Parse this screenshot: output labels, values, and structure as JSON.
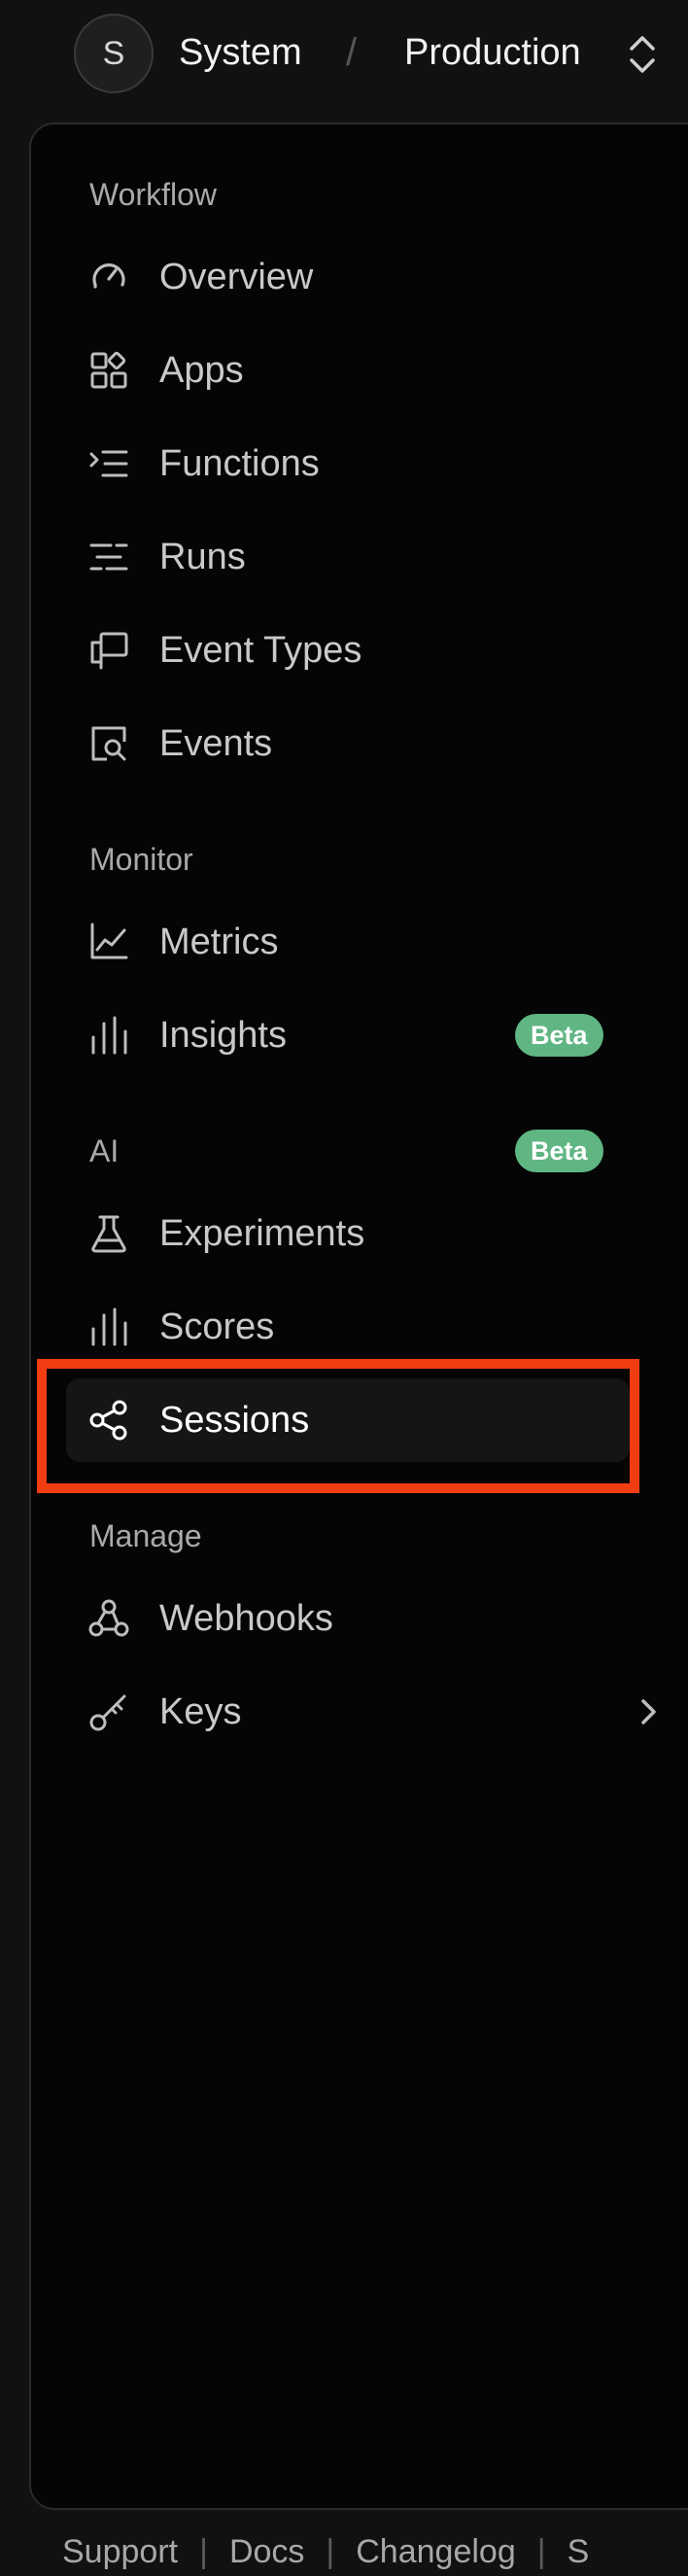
{
  "topbar": {
    "avatar_letter": "S",
    "org_name": "System",
    "separator": "/",
    "environment": "Production"
  },
  "sidebar": {
    "sections": {
      "workflow": "Workflow",
      "monitor": "Monitor",
      "ai": "AI",
      "manage": "Manage"
    },
    "items": [
      {
        "label": "Overview",
        "icon": "gauge-icon"
      },
      {
        "label": "Apps",
        "icon": "apps-grid-icon"
      },
      {
        "label": "Functions",
        "icon": "functions-list-icon"
      },
      {
        "label": "Runs",
        "icon": "runs-lines-icon"
      },
      {
        "label": "Event Types",
        "icon": "event-types-icon"
      },
      {
        "label": "Events",
        "icon": "events-search-icon"
      },
      {
        "label": "Metrics",
        "icon": "line-chart-icon"
      },
      {
        "label": "Insights",
        "icon": "bar-chart-icon",
        "badge": "Beta"
      },
      {
        "label": "Experiments",
        "icon": "flask-icon"
      },
      {
        "label": "Scores",
        "icon": "bar-chart-icon"
      },
      {
        "label": "Sessions",
        "icon": "share-nodes-icon",
        "active": true
      },
      {
        "label": "Webhooks",
        "icon": "webhook-icon"
      },
      {
        "label": "Keys",
        "icon": "key-icon",
        "has_submenu": true
      }
    ],
    "ai_badge": "Beta"
  },
  "footer": {
    "links": [
      "Support",
      "Docs",
      "Changelog",
      "S"
    ],
    "separator": "|"
  },
  "colors": {
    "background": "#050505",
    "badge": "#5fb683",
    "highlight": "#f23d12",
    "active_item": "#151516"
  }
}
